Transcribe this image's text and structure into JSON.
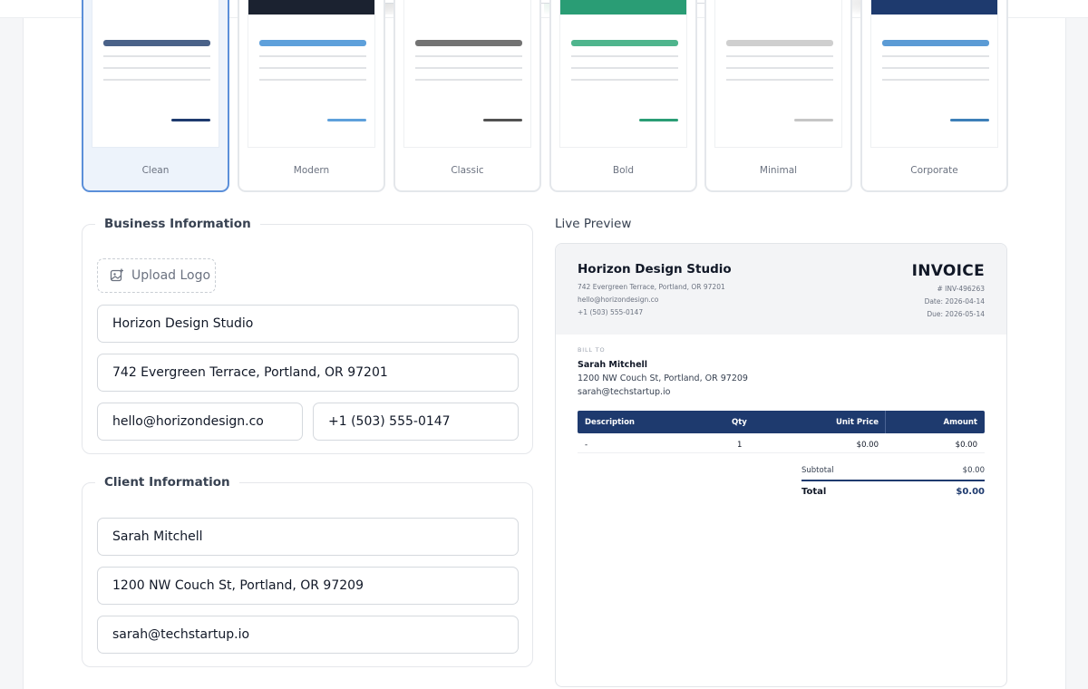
{
  "templates": [
    {
      "label": "Clean",
      "band": "",
      "accent": "#4a6289",
      "footer": "#1e3a6e",
      "active": true
    },
    {
      "label": "Modern",
      "band": "#1b2230",
      "accent": "#5ea0db",
      "footer": "#5ea0db",
      "active": false
    },
    {
      "label": "Classic",
      "band": "",
      "accent": "#737373",
      "footer": "#525252",
      "active": false
    },
    {
      "label": "Bold",
      "band": "#2a9d75",
      "accent": "#4fb58d",
      "footer": "#2a9d75",
      "active": false
    },
    {
      "label": "Minimal",
      "band": "",
      "accent": "#cfcfcf",
      "footer": "#c6c6c6",
      "active": false
    },
    {
      "label": "Corporate",
      "band": "#1e3a6e",
      "accent": "#5b9bd5",
      "footer": "#3d7fb8",
      "active": false
    }
  ],
  "business": {
    "legend": "Business Information",
    "upload_label": "Upload Logo",
    "name": "Horizon Design Studio",
    "address": "742 Evergreen Terrace, Portland, OR 97201",
    "email": "hello@horizondesign.co",
    "phone": "+1 (503) 555-0147"
  },
  "client": {
    "legend": "Client Information",
    "name": "Sarah Mitchell",
    "address": "1200 NW Couch St, Portland, OR 97209",
    "email": "sarah@techstartup.io"
  },
  "preview": {
    "label": "Live Preview",
    "title": "INVOICE",
    "business_name": "Horizon Design Studio",
    "business_address": "742 Evergreen Terrace, Portland, OR 97201",
    "business_email": "hello@horizondesign.co",
    "business_phone": "+1 (503) 555-0147",
    "invoice_number": "# INV-496263",
    "date": "Date: 2026-04-14",
    "due": "Due: 2026-05-14",
    "bill_to_label": "BILL TO",
    "client_name": "Sarah Mitchell",
    "client_address": "1200 NW Couch St, Portland, OR 97209",
    "client_email": "sarah@techstartup.io",
    "columns": {
      "description": "Description",
      "qty": "Qty",
      "unit_price": "Unit Price",
      "amount": "Amount"
    },
    "row": {
      "description": "-",
      "qty": "1",
      "unit_price": "$0.00",
      "amount": "$0.00"
    },
    "subtotal_label": "Subtotal",
    "subtotal_value": "$0.00",
    "total_label": "Total",
    "total_value": "$0.00"
  },
  "colors": {
    "accent": "#5b8fd9",
    "table_header": "#1e3a6e",
    "total": "#1e3a6e"
  }
}
